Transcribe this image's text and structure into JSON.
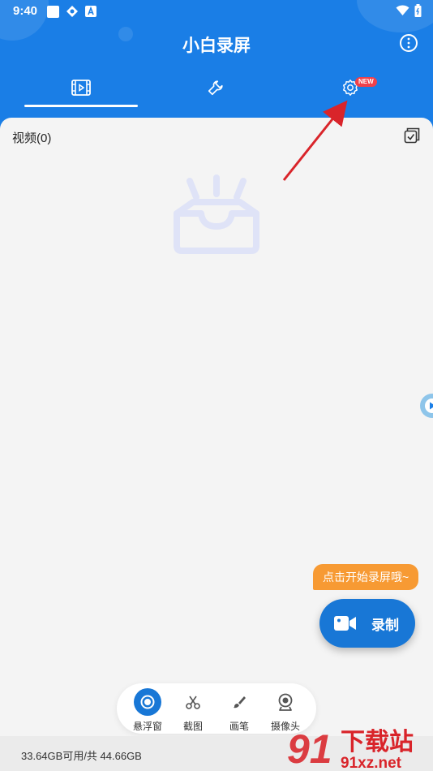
{
  "status_bar": {
    "time": "9:40"
  },
  "header": {
    "title": "小白录屏"
  },
  "tabs": [
    {
      "icon": "video-list-icon"
    },
    {
      "icon": "wrench-icon"
    },
    {
      "icon": "gear-icon"
    }
  ],
  "settings_badge": "NEW",
  "content": {
    "videos_label": "视频(0)"
  },
  "tooltip": "点击开始录屏哦~",
  "record_button": {
    "label": "录制"
  },
  "toolbar": {
    "items": [
      {
        "label": "悬浮窗",
        "icon": "floating-window-icon"
      },
      {
        "label": "截图",
        "icon": "scissors-icon"
      },
      {
        "label": "画笔",
        "icon": "brush-icon"
      },
      {
        "label": "摄像头",
        "icon": "camera-icon"
      }
    ]
  },
  "footer": {
    "storage": "33.64GB可用/共 44.66GB"
  },
  "watermark": {
    "brand": "下载站",
    "site": "91xz.net",
    "number": "91"
  },
  "colors": {
    "primary": "#1a7ee6",
    "accent_orange": "#f79a33",
    "badge_red": "#f0414a",
    "annotation_red": "#d9242a"
  }
}
